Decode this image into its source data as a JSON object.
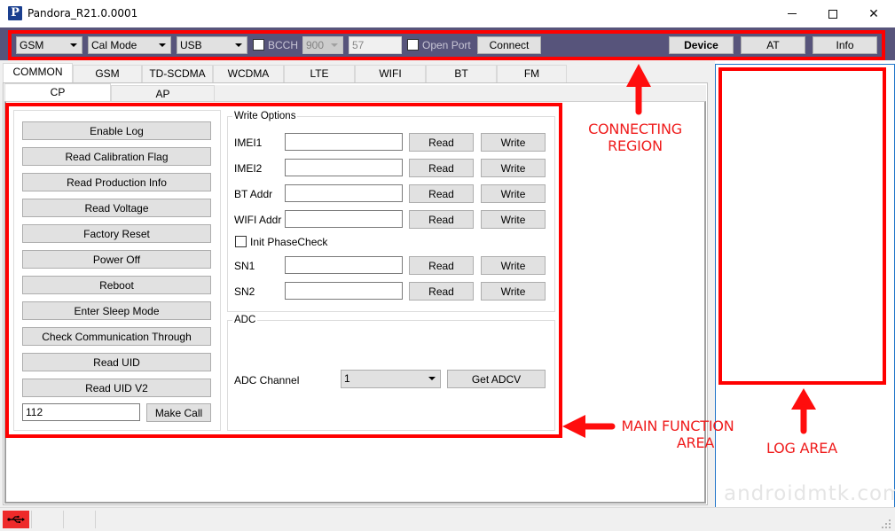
{
  "window": {
    "title": "Pandora_R21.0.0001",
    "app_icon_letter": "P",
    "controls": {
      "minimize": "minimize-icon",
      "maximize": "maximize-icon",
      "close": "✕"
    }
  },
  "toolbar": {
    "network_combo": "GSM",
    "mode_combo": "Cal Mode",
    "port_type_combo": "USB",
    "bcch_label": "BCCH",
    "bcch_checked": false,
    "band_combo": "900",
    "channel_value": "57",
    "open_port_label": "Open Port",
    "open_port_checked": false,
    "connect_label": "Connect",
    "device_label": "Device",
    "at_label": "AT",
    "info_label": "Info",
    "background_color": "#57547b"
  },
  "tabs": [
    "COMMON",
    "GSM",
    "TD-SCDMA",
    "WCDMA",
    "LTE",
    "WIFI",
    "BT",
    "FM"
  ],
  "active_tab": "COMMON",
  "subtabs": [
    "CP",
    "AP"
  ],
  "active_subtab": "CP",
  "actions": {
    "buttons": [
      "Enable Log",
      "Read Calibration Flag",
      "Read Production Info",
      "Read Voltage",
      "Factory Reset",
      "Power Off",
      "Reboot",
      "Enter Sleep Mode",
      "Check Communication Through",
      "Read UID",
      "Read UID V2"
    ],
    "call_number": "112",
    "make_call_label": "Make Call"
  },
  "write_options": {
    "title": "Write Options",
    "read_label": "Read",
    "write_label": "Write",
    "fields": [
      {
        "label": "IMEI1",
        "value": ""
      },
      {
        "label": "IMEI2",
        "value": ""
      },
      {
        "label": "BT Addr",
        "value": ""
      },
      {
        "label": "WIFI Addr",
        "value": ""
      }
    ],
    "init_phasecheck_label": "Init PhaseCheck",
    "init_phasecheck_checked": false,
    "sn_fields": [
      {
        "label": "SN1",
        "value": ""
      },
      {
        "label": "SN2",
        "value": ""
      }
    ]
  },
  "adc": {
    "title": "ADC",
    "channel_label": "ADC Channel",
    "channel_value": "1",
    "get_label": "Get ADCV"
  },
  "annotations": {
    "connecting_region": [
      "CONNECTING",
      "REGION"
    ],
    "main_function_area": [
      "MAIN FUNCTION",
      "AREA"
    ],
    "log_area": "LOG AREA",
    "color": "#ef1c1c"
  },
  "watermark": "androidmtk.com",
  "statusbar": {
    "usb_icon": "usb-icon",
    "usb_indicator_color": "#ee2a2a"
  }
}
